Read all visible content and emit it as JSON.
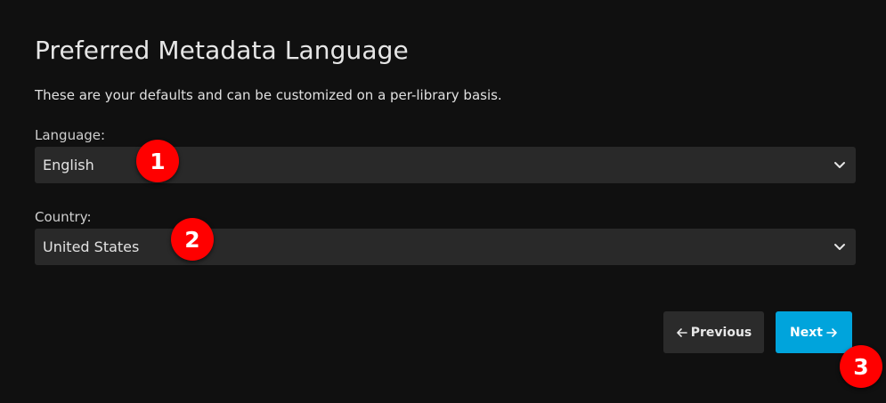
{
  "header": {
    "title": "Preferred Metadata Language",
    "description": "These are your defaults and can be customized on a per-library basis."
  },
  "form": {
    "language": {
      "label": "Language:",
      "value": "English"
    },
    "country": {
      "label": "Country:",
      "value": "United States"
    }
  },
  "actions": {
    "previous_label": "Previous",
    "next_label": "Next"
  },
  "annotations": {
    "marker_1": "1",
    "marker_2": "2",
    "marker_3": "3"
  },
  "colors": {
    "background": "#101010",
    "field_background": "#292929",
    "previous_button": "#2b2b2b",
    "next_button": "#00a4dc",
    "marker": "#ff0000"
  },
  "icons": {
    "select_chevron": "chevron-down-icon",
    "previous_arrow": "arrow-left-icon",
    "next_arrow": "arrow-right-icon"
  }
}
